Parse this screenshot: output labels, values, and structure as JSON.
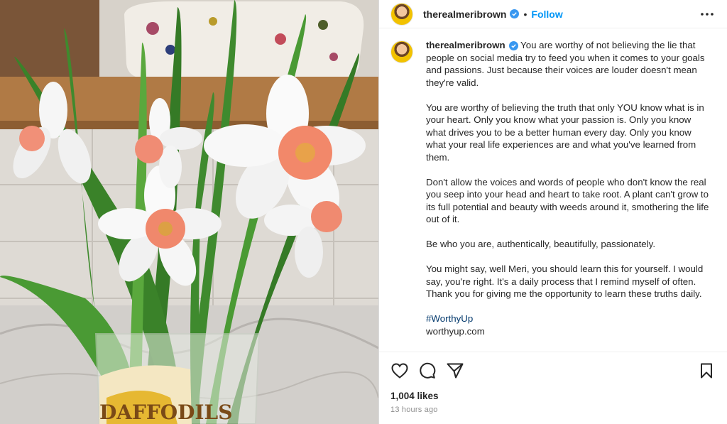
{
  "post": {
    "username": "therealmeribrown",
    "separator": "•",
    "follow_label": "Follow",
    "caption_paragraphs": [
      "You are worthy of not believing the lie that people on social media try to feed you when it comes to your goals and passions. Just because their voices are louder doesn't mean they're valid.",
      "You are worthy of believing the truth that only YOU know what is in your heart. Only you know what your passion is. Only you know what drives you to be a better human every day. Only you know what your real life experiences are and what you've learned from them.",
      "Don't allow the voices and words of people who don't know the real you seep into your head and heart to take root. A plant can't grow to its full potential and beauty with weeds around it, smothering the life out of it.",
      "Be who you are, authentically, beautifully, passionately.",
      "You might say, well Meri, you should learn this for yourself. I would say, you're right. It's a daily process that I remind myself of often. Thank you for giving me the opportunity to learn these truths daily."
    ],
    "hashtag": "#WorthyUp",
    "link": "worthyup.com",
    "likes": "1,004 likes",
    "time": "13 hours ago"
  },
  "photo": {
    "label_text": "DAFFODILS"
  },
  "icons": {
    "more": "more-options-icon",
    "like": "heart-icon",
    "comment": "comment-icon",
    "share": "share-icon",
    "save": "bookmark-icon",
    "verified": "verified-badge-icon"
  },
  "colors": {
    "accent": "#0095f6",
    "verified": "#3897f0",
    "hashtag": "#00376b",
    "muted": "#8e8e8e"
  }
}
